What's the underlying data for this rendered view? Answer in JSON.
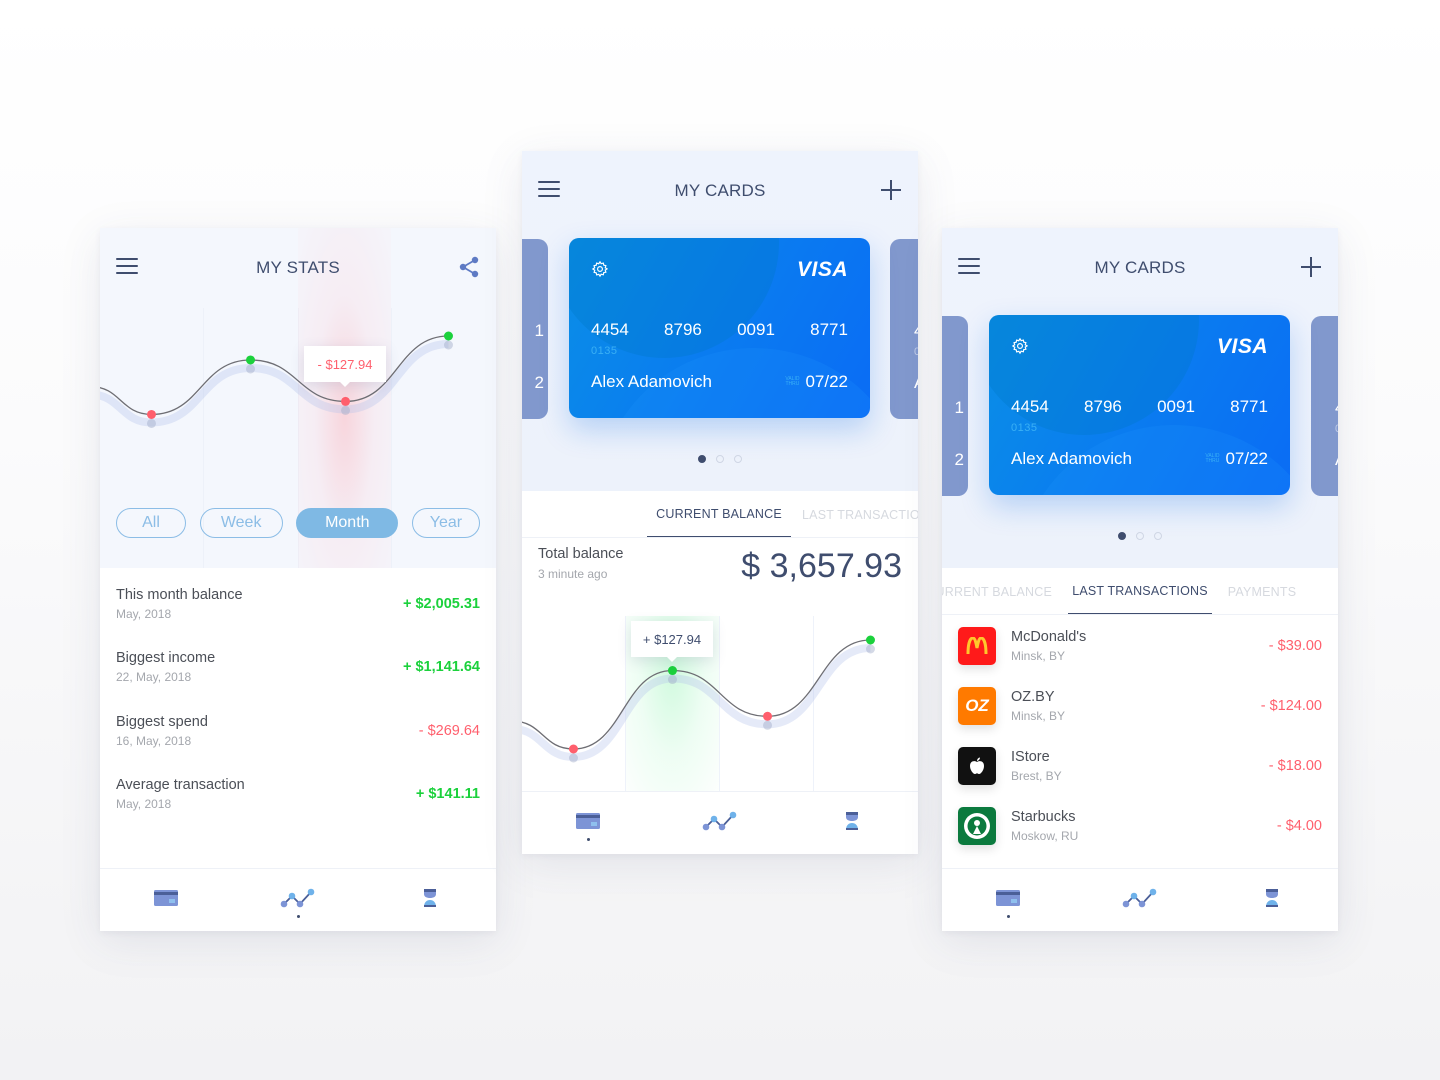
{
  "colors": {
    "positive": "#1bd13c",
    "negative": "#ff5f6d",
    "navy": "#3f4d6e",
    "pill_blue": "#7fb9e4",
    "card_blue": "#0a7cf0"
  },
  "stats_screen": {
    "title": "MY STATS",
    "menu_icon": "hamburger-icon",
    "share_icon": "share-icon",
    "tooltip": "- $127.94",
    "filters": [
      {
        "label": "All",
        "active": false
      },
      {
        "label": "Week",
        "active": false
      },
      {
        "label": "Month",
        "active": true
      },
      {
        "label": "Year",
        "active": false
      }
    ],
    "stats": [
      {
        "label": "This month balance",
        "date": "May, 2018",
        "value": "+ $2,005.31",
        "sign": "pos"
      },
      {
        "label": "Biggest income",
        "date": "22, May, 2018",
        "value": "+ $1,141.64",
        "sign": "pos"
      },
      {
        "label": "Biggest spend",
        "date": "16, May, 2018",
        "value": "- $269.64",
        "sign": "neg"
      },
      {
        "label": "Average transaction",
        "date": "May, 2018",
        "value": "+ $141.11",
        "sign": "pos"
      }
    ],
    "chart_points": [
      {
        "x": 0.13,
        "y": 0.28,
        "type": "neg"
      },
      {
        "x": 0.38,
        "y": 0.78,
        "type": "pos"
      },
      {
        "x": 0.62,
        "y": 0.4,
        "type": "neg"
      },
      {
        "x": 0.88,
        "y": 1.0,
        "type": "pos"
      }
    ],
    "nav": [
      {
        "icon": "card-icon",
        "active": false
      },
      {
        "icon": "chart-icon",
        "active": true
      },
      {
        "icon": "profile-icon",
        "active": false
      }
    ]
  },
  "balance_screen": {
    "title": "MY CARDS",
    "menu_icon": "hamburger-icon",
    "add_icon": "plus-icon",
    "card": {
      "brand": "VISA",
      "number_groups": [
        "4454",
        "8796",
        "0091",
        "8771"
      ],
      "sub_number": "0135",
      "holder": "Alex Adamovich",
      "valid_label_1": "VALID",
      "valid_label_2": "THRU",
      "expiry": "07/22"
    },
    "side_left_chars": [
      "1",
      "2"
    ],
    "side_right_chars": [
      "4",
      "0",
      "A"
    ],
    "carousel_count": 3,
    "carousel_active": 0,
    "tabs": [
      {
        "label": "CURRENT BALANCE",
        "active": true
      },
      {
        "label": "LAST TRANSACTIONS",
        "active": false
      }
    ],
    "total_label": "Total balance",
    "updated": "3 minute ago",
    "total_amount": "$ 3,657.93",
    "tooltip": "+ $127.94",
    "chart_points": [
      {
        "x": 0.13,
        "y": 0.0,
        "type": "neg"
      },
      {
        "x": 0.38,
        "y": 0.72,
        "type": "pos"
      },
      {
        "x": 0.62,
        "y": 0.3,
        "type": "neg"
      },
      {
        "x": 0.88,
        "y": 1.0,
        "type": "pos"
      }
    ],
    "nav": [
      {
        "icon": "card-icon",
        "active": true
      },
      {
        "icon": "chart-icon",
        "active": false
      },
      {
        "icon": "profile-icon",
        "active": false
      }
    ]
  },
  "tx_screen": {
    "title": "MY CARDS",
    "menu_icon": "hamburger-icon",
    "add_icon": "plus-icon",
    "card": {
      "brand": "VISA",
      "number_groups": [
        "4454",
        "8796",
        "0091",
        "8771"
      ],
      "sub_number": "0135",
      "holder": "Alex Adamovich",
      "valid_label_1": "VALID",
      "valid_label_2": "THRU",
      "expiry": "07/22"
    },
    "tabs": [
      {
        "label": "CURRENT BALANCE",
        "active": false
      },
      {
        "label": "LAST TRANSACTIONS",
        "active": true
      },
      {
        "label": "PAYMENTS",
        "active": false
      }
    ],
    "transactions": [
      {
        "name": "McDonald's",
        "location": "Minsk, BY",
        "amount": "- $39.00",
        "logo": "mcdonalds-logo",
        "logo_bg": "#ff1a1a",
        "logo_text": "m",
        "logo_fg": "#ffc72c"
      },
      {
        "name": "OZ.BY",
        "location": "Minsk, BY",
        "amount": "- $124.00",
        "logo": "ozby-logo",
        "logo_bg": "#ff7a00",
        "logo_text": "OZ",
        "logo_fg": "#ffffff"
      },
      {
        "name": "IStore",
        "location": "Brest, BY",
        "amount": "- $18.00",
        "logo": "apple-logo",
        "logo_bg": "#111111",
        "logo_text": "",
        "logo_fg": "#ffffff"
      },
      {
        "name": "Starbucks",
        "location": "Moskow, RU",
        "amount": "- $4.00",
        "logo": "starbucks-logo",
        "logo_bg": "#0b7a3e",
        "logo_text": "",
        "logo_fg": "#ffffff"
      }
    ],
    "nav": [
      {
        "icon": "card-icon",
        "active": true
      },
      {
        "icon": "chart-icon",
        "active": false
      },
      {
        "icon": "profile-icon",
        "active": false
      }
    ]
  }
}
